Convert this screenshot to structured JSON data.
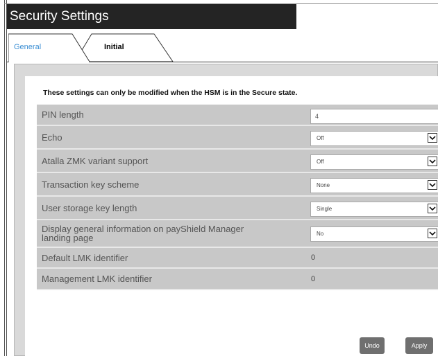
{
  "window": {
    "title": "Security Settings"
  },
  "tabs": [
    {
      "label": "General",
      "active": true
    },
    {
      "label": "Initial",
      "active": false
    }
  ],
  "notice": "These settings can only be modified when the HSM is in the Secure state.",
  "settings": [
    {
      "label": "PIN length",
      "control": "text",
      "value": "4"
    },
    {
      "label": "Echo",
      "control": "select",
      "value": "Off"
    },
    {
      "label": "Atalla ZMK variant support",
      "control": "select",
      "value": "Off"
    },
    {
      "label": "Transaction key scheme",
      "control": "select",
      "value": "None"
    },
    {
      "label": "User storage key length",
      "control": "select",
      "value": "Single"
    },
    {
      "label": "Display general information on payShield Manager landing page",
      "control": "select",
      "value": "No"
    },
    {
      "label": "Default LMK identifier",
      "control": "static",
      "value": "0"
    },
    {
      "label": "Management LMK identifier",
      "control": "static",
      "value": "0"
    }
  ],
  "buttons": {
    "undo": "Undo",
    "apply": "Apply"
  },
  "colors": {
    "title_bar": "#242424",
    "active_tab_text": "#3c8fd4",
    "row_bg": "#c8c8c8",
    "button_bg": "#6f6f6f"
  }
}
